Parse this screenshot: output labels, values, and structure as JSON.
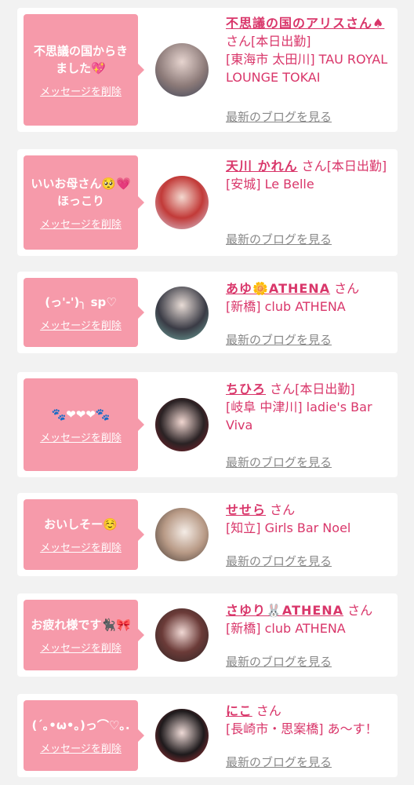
{
  "blog_link_label": "最新のブログを見る",
  "delete_label": "メッセージを削除",
  "san_label": "さん",
  "entries": [
    {
      "message": "不思議の国からきました💖",
      "name": "不思議の国のアリスさん♠",
      "status": "[本日出勤]",
      "shop": "[東海市 太田川] TAU ROYAL LOUNGE TOKAI"
    },
    {
      "message": "いいお母さん🥺💗ほっこり",
      "name": "天川 かれん",
      "status": "[本日出勤]",
      "shop": "[安城] Le Belle"
    },
    {
      "message": "(っ'-')╮ sp♡",
      "name": "あゆ🌼ATHENA",
      "status": "",
      "shop": "[新橋] club ATHENA"
    },
    {
      "message": "🐾❤❤❤🐾",
      "name": "ちひろ",
      "status": "[本日出勤]",
      "shop": "[岐阜 中津川] ladie's Bar Viva"
    },
    {
      "message": "おいしそー☺️",
      "name": "せせら",
      "status": "",
      "shop": "[知立] Girls Bar Noel"
    },
    {
      "message": "お疲れ様です🐈‍⬛🎀",
      "name": "さゆり🐰ATHENA",
      "status": "",
      "shop": "[新橋] club ATHENA"
    },
    {
      "message": "(´｡•ω•｡)っ⌒♡｡.",
      "name": "にこ",
      "status": "",
      "shop": "[長崎市・思案橋] あ〜す！"
    }
  ]
}
